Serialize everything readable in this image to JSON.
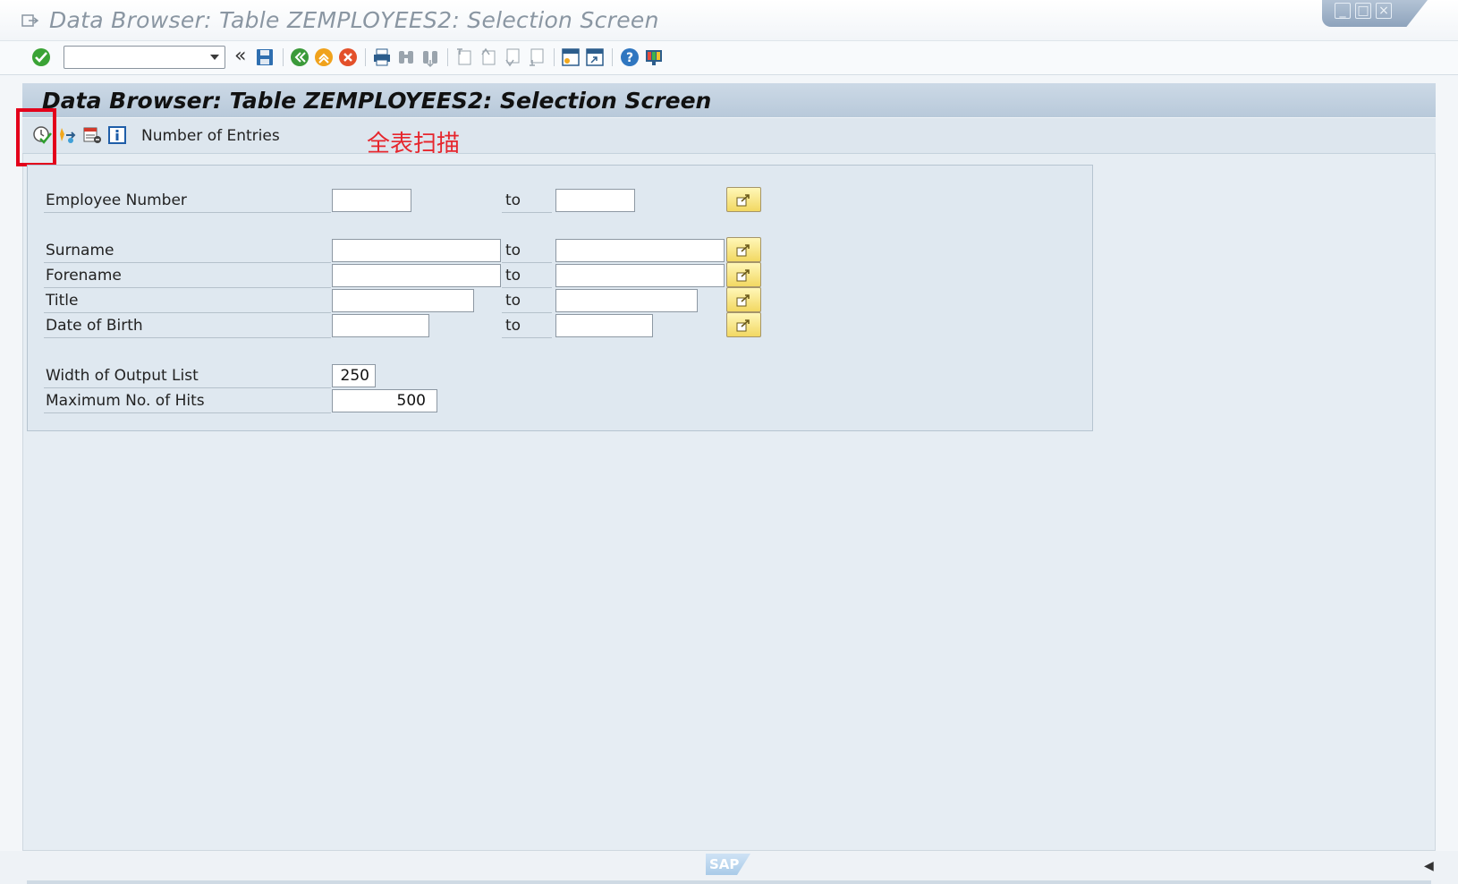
{
  "window": {
    "title": "Data Browser: Table ZEMPLOYEES2: Selection Screen"
  },
  "command_field": {
    "value": ""
  },
  "page": {
    "title": "Data Browser: Table ZEMPLOYEES2: Selection Screen"
  },
  "app_toolbar": {
    "number_of_entries_label": "Number of Entries"
  },
  "annotation": {
    "text": "全表扫描",
    "color": "#e6262d"
  },
  "fields": [
    {
      "label": "Employee Number",
      "from": "",
      "to": "",
      "to_label": "to"
    },
    {
      "label": "Surname",
      "from": "",
      "to": "",
      "to_label": "to"
    },
    {
      "label": "Forename",
      "from": "",
      "to": "",
      "to_label": "to"
    },
    {
      "label": "Title",
      "from": "",
      "to": "",
      "to_label": "to"
    },
    {
      "label": "Date of Birth",
      "from": "",
      "to": "",
      "to_label": "to"
    }
  ],
  "settings": {
    "width_label": "Width of Output List",
    "width_value": "250",
    "max_hits_label": "Maximum No. of Hits",
    "max_hits_value": "500"
  },
  "footer": {
    "logo_text": "SAP"
  },
  "colors": {
    "header_bg": "#b8c9da",
    "panel_bg": "#e6edf3",
    "highlight": "#e3001b"
  }
}
